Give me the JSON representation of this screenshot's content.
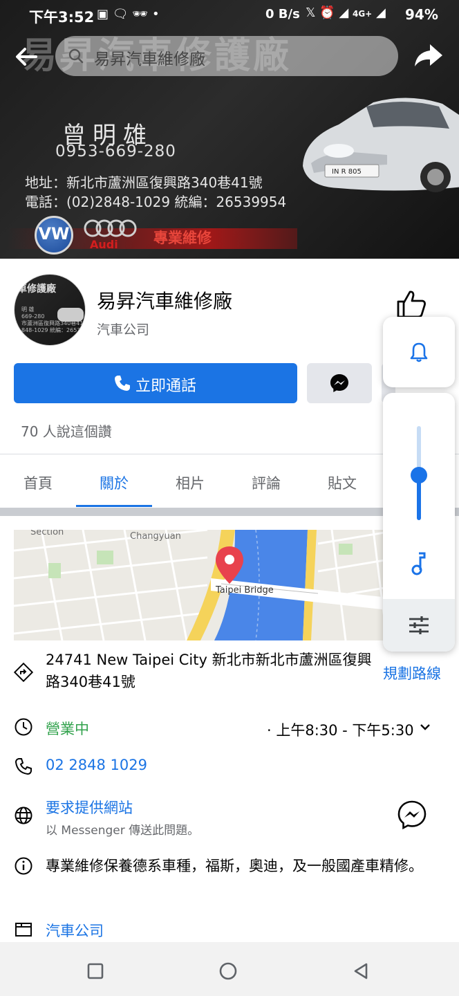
{
  "status_bar": {
    "time": "下午3:52",
    "net_speed": "0 B/s",
    "network_type": "4G+",
    "battery": "94%",
    "icons_left": [
      "rec-icon",
      "chat-bubble-icon",
      "incognito-icon",
      "dot-icon"
    ],
    "icons_right": [
      "x-icon",
      "alarm-icon",
      "signal-icon",
      "signal-4g-icon"
    ]
  },
  "cover": {
    "watermark": "易昇汽車修護廠",
    "card_name": "曾明雄",
    "card_mobile": "0953-669-280",
    "card_address": "地址：新北市蘆洲區復興路340巷41號",
    "card_phone": "電話：(02)2848-1029 統編：26539954",
    "brand_vw": "VW",
    "brand_audi": "Audi",
    "tagline": "專業維修",
    "plate": "IN R 805"
  },
  "header": {
    "search_text": "易昇汽車維修廠"
  },
  "profile": {
    "name": "易昇汽車維修廠",
    "category": "汽車公司",
    "avatar_text": "車修護廠",
    "avatar_sub": "明 雄\n669-280\n市蘆洲區復興路340巷41號\n848-1029 統編：26539954",
    "call_label": "立即通話",
    "likes": "70 人說這個讚"
  },
  "tabs": [
    {
      "label": "首頁",
      "active": false
    },
    {
      "label": "關於",
      "active": true
    },
    {
      "label": "相片",
      "active": false
    },
    {
      "label": "評論",
      "active": false
    },
    {
      "label": "貼文",
      "active": false
    }
  ],
  "map": {
    "labels": [
      "Section",
      "Changyuan",
      "Taipei Bridge"
    ]
  },
  "info": {
    "address": "24741 New Taipei City 新北市新北市蘆洲區復興路340巷41號",
    "directions": "規劃路線",
    "open_status": "營業中",
    "hours": "· 上午8:30 - 下午5:30",
    "phone": "02 2848 1029",
    "website_request": "要求提供網站",
    "website_sub": "以 Messenger 傳送此問題。",
    "description": "專業維修保養德系車種，福斯，奧迪，及一般國產車精修。",
    "category_link": "汽車公司"
  },
  "volume_panel": {
    "level": 0.48,
    "icons": [
      "bell-icon",
      "music-note-icon",
      "equalizer-settings-icon"
    ]
  },
  "colors": {
    "accent": "#1b74e4",
    "open": "#31a24c",
    "volume": "#1a73e8"
  }
}
